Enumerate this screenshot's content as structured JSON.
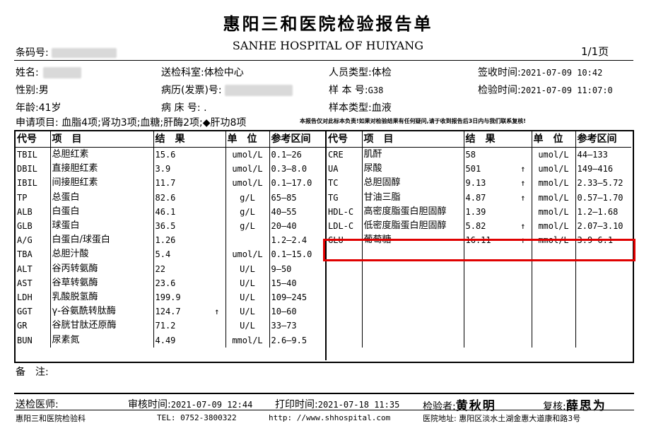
{
  "header": {
    "title": "惠阳三和医院检验报告单",
    "subtitle": "SANHE HOSPITAL OF HUIYANG",
    "barcode_label": "条码号:",
    "page": "1/1页"
  },
  "patient": {
    "name_label": "姓名:",
    "sex_label": "性别:",
    "sex": "男",
    "age_label": "年龄:",
    "age": "41岁",
    "dept_label": "送检科室:",
    "dept": "体检中心",
    "record_label": "病历(发票)号:",
    "bed_label": "病 床 号:",
    "bed": ".",
    "person_type_label": "人员类型:",
    "person_type": "体检",
    "sample_no_label": "样 本 号:",
    "sample_no": "G38",
    "sample_type_label": "样本类型:",
    "sample_type": "血液",
    "receive_label": "签收时间:",
    "receive_time": "2021-07-09 10:42",
    "test_label": "检验时间:",
    "test_time": "2021-07-09 11:07:0"
  },
  "request": {
    "text": "申请项目: 血脂4项;肾功3项;血糖;肝酶2项;◆肝功8项",
    "notice": "本报告仅对此标本负责!如果对检验结果有任何疑问,请于收到报告后3日内与我们联系复核!"
  },
  "columns": {
    "code": "代号",
    "item": "项　目",
    "result": "结　果",
    "unit": "单　位",
    "ref": "参考区间"
  },
  "left_rows": [
    {
      "code": "TBIL",
      "name": "总胆红素",
      "result": "15.6",
      "flag": "",
      "unit": "umol/L",
      "ref": "0.1—26"
    },
    {
      "code": "DBIL",
      "name": "直接胆红素",
      "result": "3.9",
      "flag": "",
      "unit": "umol/L",
      "ref": "0.3—8.0"
    },
    {
      "code": "IBIL",
      "name": "间接胆红素",
      "result": "11.7",
      "flag": "",
      "unit": "umol/L",
      "ref": "0.1—17.0"
    },
    {
      "code": "TP",
      "name": "总蛋白",
      "result": "82.6",
      "flag": "",
      "unit": "g/L",
      "ref": "65—85"
    },
    {
      "code": "ALB",
      "name": "白蛋白",
      "result": "46.1",
      "flag": "",
      "unit": "g/L",
      "ref": "40—55"
    },
    {
      "code": "GLB",
      "name": "球蛋白",
      "result": "36.5",
      "flag": "",
      "unit": "g/L",
      "ref": "20—40"
    },
    {
      "code": "A/G",
      "name": "白蛋白/球蛋白",
      "result": "1.26",
      "flag": "",
      "unit": "",
      "ref": "1.2—2.4"
    },
    {
      "code": "TBA",
      "name": "总胆汁酸",
      "result": "5.4",
      "flag": "",
      "unit": "umol/L",
      "ref": "0.1—15.0"
    },
    {
      "code": "ALT",
      "name": "谷丙转氨酶",
      "result": "22",
      "flag": "",
      "unit": "U/L",
      "ref": "9—50"
    },
    {
      "code": "AST",
      "name": "谷草转氨酶",
      "result": "23.6",
      "flag": "",
      "unit": "U/L",
      "ref": "15—40"
    },
    {
      "code": "LDH",
      "name": "乳酸脱氢酶",
      "result": "199.9",
      "flag": "",
      "unit": "U/L",
      "ref": "109—245"
    },
    {
      "code": "GGT",
      "name": "γ-谷氨酰转肽酶",
      "result": "124.7",
      "flag": "↑",
      "unit": "U/L",
      "ref": "10—60"
    },
    {
      "code": "GR",
      "name": "谷胱甘肽还原酶",
      "result": "71.2",
      "flag": "",
      "unit": "U/L",
      "ref": "33—73"
    },
    {
      "code": "BUN",
      "name": "尿素氮",
      "result": "4.49",
      "flag": "",
      "unit": "mmol/L",
      "ref": "2.6—9.5"
    }
  ],
  "right_rows": [
    {
      "code": "CRE",
      "name": "肌酐",
      "result": "58",
      "flag": "",
      "unit": "umol/L",
      "ref": "44—133"
    },
    {
      "code": "UA",
      "name": "尿酸",
      "result": "501",
      "flag": "↑",
      "unit": "umol/L",
      "ref": "149—416"
    },
    {
      "code": "TC",
      "name": "总胆固醇",
      "result": "9.13",
      "flag": "↑",
      "unit": "mmol/L",
      "ref": "2.33—5.72"
    },
    {
      "code": "TG",
      "name": "甘油三脂",
      "result": "4.87",
      "flag": "↑",
      "unit": "mmol/L",
      "ref": "0.57—1.70"
    },
    {
      "code": "HDL-C",
      "name": "高密度脂蛋白胆固醇",
      "result": "1.39",
      "flag": "",
      "unit": "mmol/L",
      "ref": "1.2—1.68"
    },
    {
      "code": "LDL-C",
      "name": "低密度脂蛋白胆固醇",
      "result": "5.82",
      "flag": "↑",
      "unit": "mmol/L",
      "ref": "2.07—3.10"
    },
    {
      "code": "GLU",
      "name": "葡萄糖",
      "result": "16.11",
      "flag": "↑",
      "unit": "mmol/L",
      "ref": "3.9—6.1"
    }
  ],
  "remarks_label": "备　注:",
  "footer": {
    "doctor_label": "送检医师:",
    "review_time_label": "审核时间:",
    "review_time": "2021-07-09 12:44",
    "print_time_label": "打印时间:",
    "print_time": "2021-07-18 11:35",
    "tester_label": "检验者:",
    "tester": "黄秋明",
    "rechecker_label": "复核:",
    "rechecker": "薛思为",
    "dept": "惠阳三和医院检验科",
    "tel": "TEL: 0752-3800322",
    "url": "http: //www.shhospital.com",
    "address": "医院地址: 惠阳区淡水土湖金惠大道康和路3号"
  },
  "colors": {
    "highlight": "#e00000"
  }
}
